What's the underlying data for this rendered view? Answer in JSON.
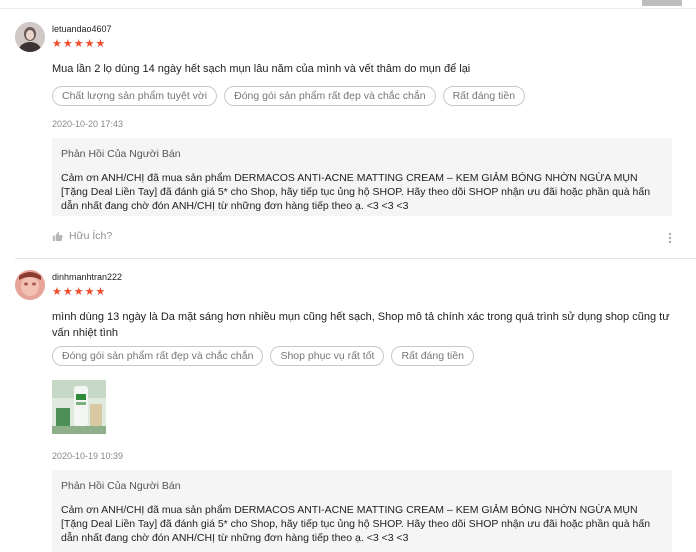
{
  "reviews": [
    {
      "username": "letuandao4607",
      "rating": 5,
      "stars": "★★★★★",
      "comment": "Mua lần 2 lọ dùng 14 ngày hết sạch mụn lâu năm của mình và vết thâm do mụn để lại",
      "tags": [
        "Chất lượng sản phẩm tuyệt vời",
        "Đóng gói sản phẩm rất đẹp và chắc chắn",
        "Rất đáng tiền"
      ],
      "date": "2020-10-20 17:43",
      "reply_title": "Phản Hồi Của Người Bán",
      "reply_text": "Cảm ơn  ANH/CHỊ đã mua sản phẩm DERMACOS ANTI-ACNE MATTING CREAM – KEM GIẢM BÓNG NHỜN NGỪA MỤN [Tặng Deal Liền Tay] đã đánh giá 5* cho Shop, hãy tiếp tục ủng hộ SHOP. Hãy theo dõi SHOP nhận ưu đãi hoặc phần quà hấn dẫn nhất đang chờ đón  ANH/CHỊ từ những đơn hàng tiếp theo ạ. <3 <3 <3",
      "helpful": "Hữu Ích?"
    },
    {
      "username": "dinhmanhtran222",
      "rating": 5,
      "stars": "★★★★★",
      "comment": " mình dùng 13 ngày là Da mặt sáng hơn nhiều mụn cũng hết sạch, Shop mô tả chính xác trong quá trình sử dụng shop cũng tư vấn nhiệt tình",
      "tags": [
        "Đóng gói sản phẩm rất đẹp và chắc chắn",
        "Shop phục vụ rất tốt",
        "Rất đáng tiền"
      ],
      "date": "2020-10-19 10:39",
      "reply_title": "Phản Hồi Của Người Bán",
      "reply_text": "Cảm ơn  ANH/CHỊ đã mua sản phẩm DERMACOS ANTI-ACNE MATTING CREAM – KEM GIẢM BÓNG NHỜN NGỪA MỤN [Tặng Deal Liền Tay] đã đánh giá 5* cho Shop, hãy tiếp tục ủng hộ SHOP. Hãy theo dõi SHOP nhận ưu đãi hoặc phần quà hấn dẫn nhất đang chờ đón  ANH/CHỊ từ những đơn hàng tiếp theo ạ. <3 <3 <3"
    }
  ],
  "icons": {
    "star": "star-icon",
    "thumbs_up": "thumbs-up-icon",
    "more": "more-vertical-icon"
  },
  "colors": {
    "star": "#ee4d2d",
    "reply_bg": "#f5f5f5",
    "tag_border": "#c9c9c9"
  }
}
